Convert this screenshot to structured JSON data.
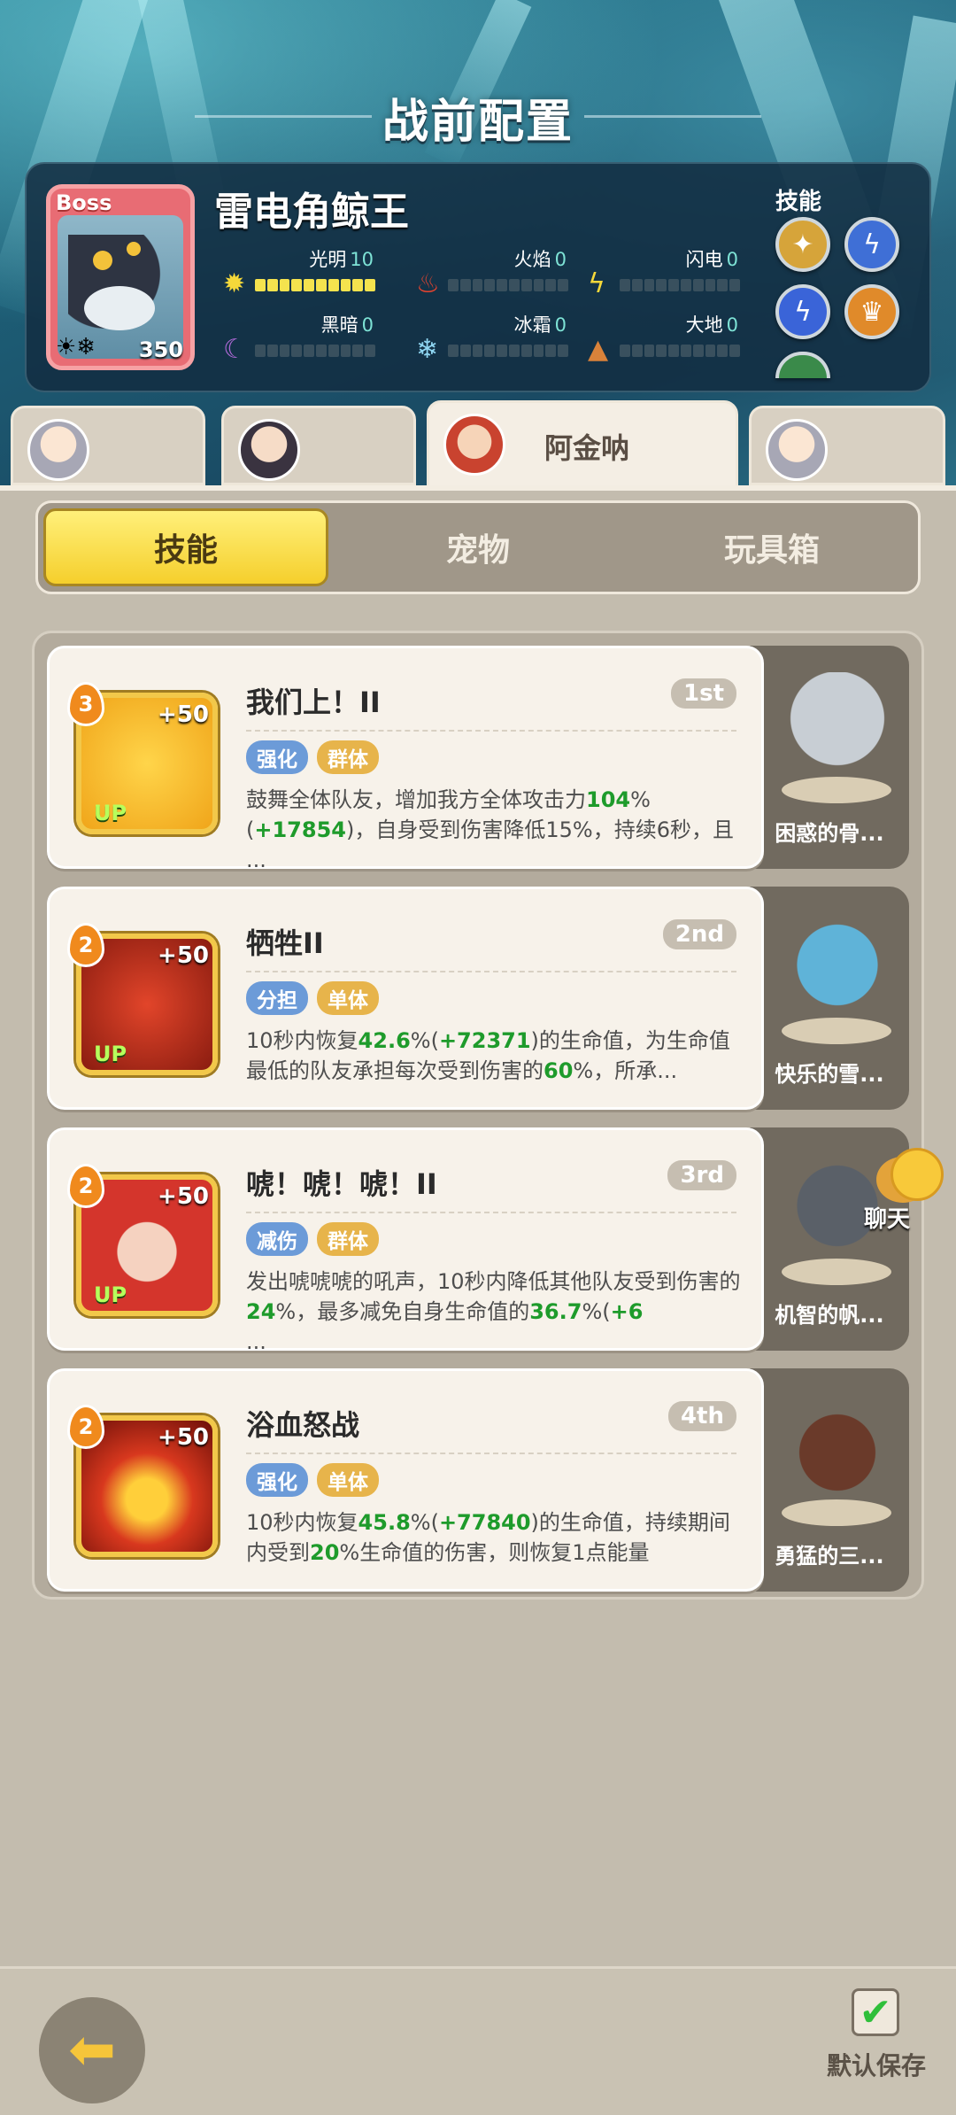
{
  "header": {
    "title": "战前配置"
  },
  "boss": {
    "tag": "Boss",
    "name": "雷电角鲸王",
    "level": "350",
    "stats": [
      {
        "label": "光明",
        "value": "10",
        "icon": "sun-icon"
      },
      {
        "label": "火焰",
        "value": "0",
        "icon": "fire-icon"
      },
      {
        "label": "闪电",
        "value": "0",
        "icon": "lightning-icon"
      },
      {
        "label": "黑暗",
        "value": "0",
        "icon": "moon-icon"
      },
      {
        "label": "冰霜",
        "value": "0",
        "icon": "snowflake-icon"
      },
      {
        "label": "大地",
        "value": "0",
        "icon": "earth-icon"
      }
    ],
    "skills_label": "技能"
  },
  "hero_tabs": [
    {
      "name": "",
      "active": false
    },
    {
      "name": "",
      "active": false
    },
    {
      "name": "阿金呐",
      "active": true
    },
    {
      "name": "",
      "active": false
    }
  ],
  "segment": {
    "items": [
      "技能",
      "宠物",
      "玩具箱"
    ],
    "active": 0
  },
  "skills": [
    {
      "level": "3",
      "bonus": "+50",
      "up": "UP",
      "name": "我们上！II",
      "rank": "1st",
      "tags": [
        "强化",
        "群体"
      ],
      "desc_parts": [
        "鼓舞全体队友，增加我方全体攻击力",
        "104",
        "%(",
        "+17854",
        ")，自身受到伤害降低15%，持续6秒，且",
        "",
        "..."
      ],
      "pet": "困惑的骨..."
    },
    {
      "level": "2",
      "bonus": "+50",
      "up": "UP",
      "name": "牺牲II",
      "rank": "2nd",
      "tags": [
        "分担",
        "单体"
      ],
      "desc_parts": [
        "10秒内恢复",
        "42.6",
        "%(",
        "+72371",
        ")的生命值，为生命值最低的队友承担每次受到伤害的",
        "60",
        "%，所承..."
      ],
      "pet": "快乐的雪..."
    },
    {
      "level": "2",
      "bonus": "+50",
      "up": "UP",
      "name": "唬！唬！唬！II",
      "rank": "3rd",
      "tags": [
        "减伤",
        "群体"
      ],
      "desc_parts": [
        "发出唬唬唬的吼声，10秒内降低其他队友受到伤害的",
        "24",
        "%，最多减免自身生命值的",
        "36.7",
        "%(",
        "+6",
        "..."
      ],
      "pet": "机智的帆..."
    },
    {
      "level": "2",
      "bonus": "+50",
      "up": "",
      "name": "浴血怒战",
      "rank": "4th",
      "tags": [
        "强化",
        "单体"
      ],
      "desc_parts": [
        "10秒内恢复",
        "45.8",
        "%(",
        "+77840",
        ")的生命值，持续期间内受到",
        "20",
        "%生命值的伤害，则恢复1点能量"
      ],
      "pet": "勇猛的三..."
    }
  ],
  "chat": {
    "label": "聊天"
  },
  "footer": {
    "save_label": "默认保存"
  }
}
